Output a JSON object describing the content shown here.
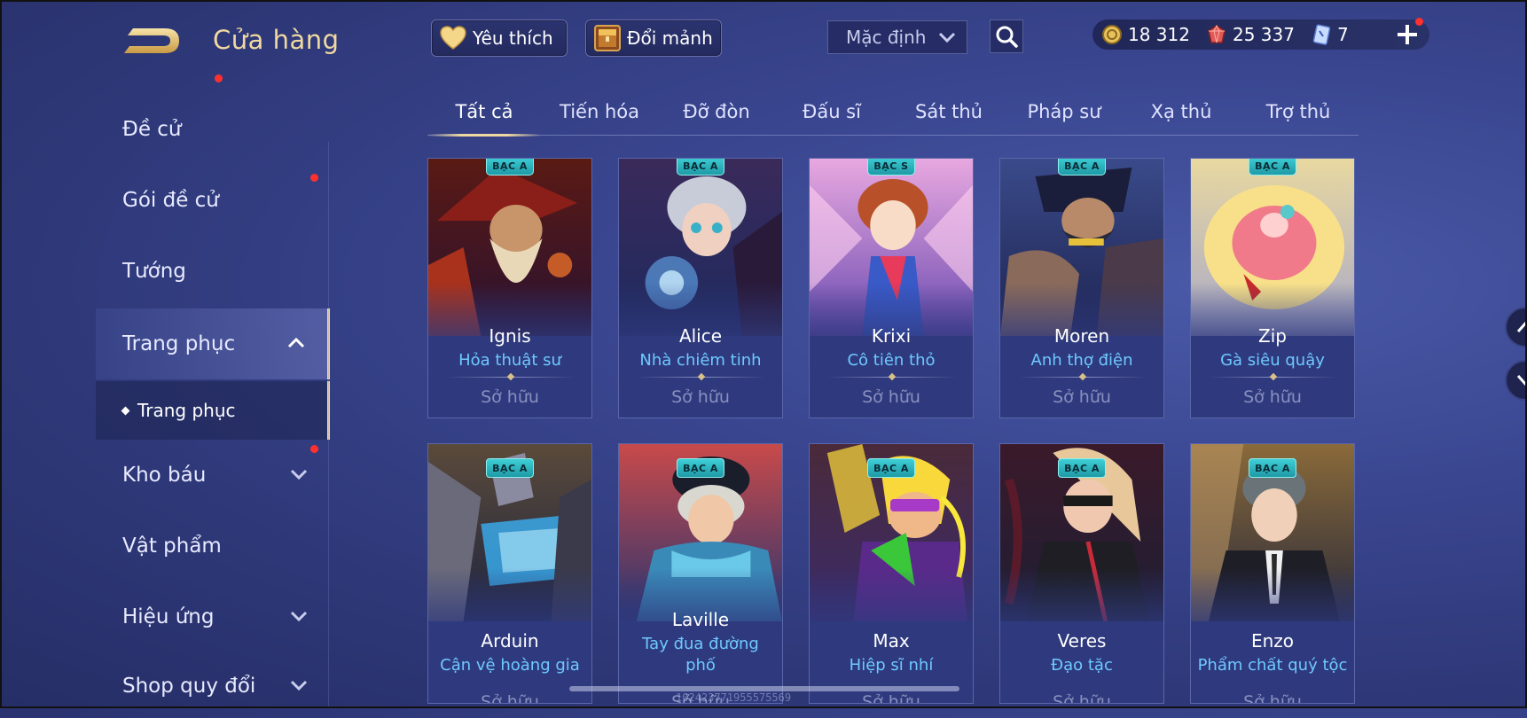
{
  "header": {
    "title": "Cửa hàng",
    "favorite_label": "Yêu thích",
    "shard_label": "Đổi mảnh",
    "sort_value": "Mặc định"
  },
  "currencies": [
    {
      "icon": "gold-coin-icon",
      "value": "18 312",
      "color": "#e8c15a"
    },
    {
      "icon": "red-gem-icon",
      "value": "25 337",
      "color": "#e05a5a"
    },
    {
      "icon": "blue-card-icon",
      "value": "7",
      "color": "#8fb8ff"
    }
  ],
  "sidebar": {
    "items": [
      {
        "label": "Đề cử",
        "has_dot": false,
        "chevron": "none"
      },
      {
        "label": "Gói đề cử",
        "has_dot": true,
        "chevron": "none"
      },
      {
        "label": "Tướng",
        "has_dot": false,
        "chevron": "none"
      },
      {
        "label": "Trang phục",
        "has_dot": false,
        "chevron": "up",
        "active": true
      },
      {
        "label": "Kho báu",
        "has_dot": true,
        "chevron": "down"
      },
      {
        "label": "Vật phẩm",
        "has_dot": false,
        "chevron": "none"
      },
      {
        "label": "Hiệu ứng",
        "has_dot": false,
        "chevron": "down"
      },
      {
        "label": "Shop quy đổi",
        "has_dot": false,
        "chevron": "down"
      }
    ],
    "sub_item": "Trang phục"
  },
  "tabs": [
    "Tất cả",
    "Tiến hóa",
    "Đỡ đòn",
    "Đấu sĩ",
    "Sát thủ",
    "Pháp sư",
    "Xạ thủ",
    "Trợ thủ"
  ],
  "active_tab": 0,
  "owned_label": "Sở hữu",
  "cards": [
    {
      "badge": "BẠC A",
      "hero": "Ignis",
      "skin": "Hỏa thuật sư",
      "art": "ignis"
    },
    {
      "badge": "BẠC A",
      "hero": "Alice",
      "skin": "Nhà chiêm tinh",
      "art": "alice"
    },
    {
      "badge": "BẠC S",
      "hero": "Krixi",
      "skin": "Cô tiên thỏ",
      "art": "krixi"
    },
    {
      "badge": "BẠC A",
      "hero": "Moren",
      "skin": "Anh thợ điện",
      "art": "moren"
    },
    {
      "badge": "BẠC A",
      "hero": "Zip",
      "skin": "Gà siêu quậy",
      "art": "zip"
    },
    {
      "badge": "BẠC A",
      "hero": "Arduin",
      "skin": "Cận vệ hoàng gia",
      "art": "arduin"
    },
    {
      "badge": "BẠC A",
      "hero": "Laville",
      "skin_line1": "Tay đua đường",
      "skin_line2": "phố",
      "art": "laville"
    },
    {
      "badge": "BẠC A",
      "hero": "Max",
      "skin": "Hiệp sĩ nhí",
      "art": "max"
    },
    {
      "badge": "BẠC A",
      "hero": "Veres",
      "skin": "Đạo tặc",
      "art": "veres"
    },
    {
      "badge": "BẠC A",
      "hero": "Enzo",
      "skin": "Phẩm chất quý tộc",
      "art": "enzo"
    }
  ],
  "watermark": "102423771955575569"
}
